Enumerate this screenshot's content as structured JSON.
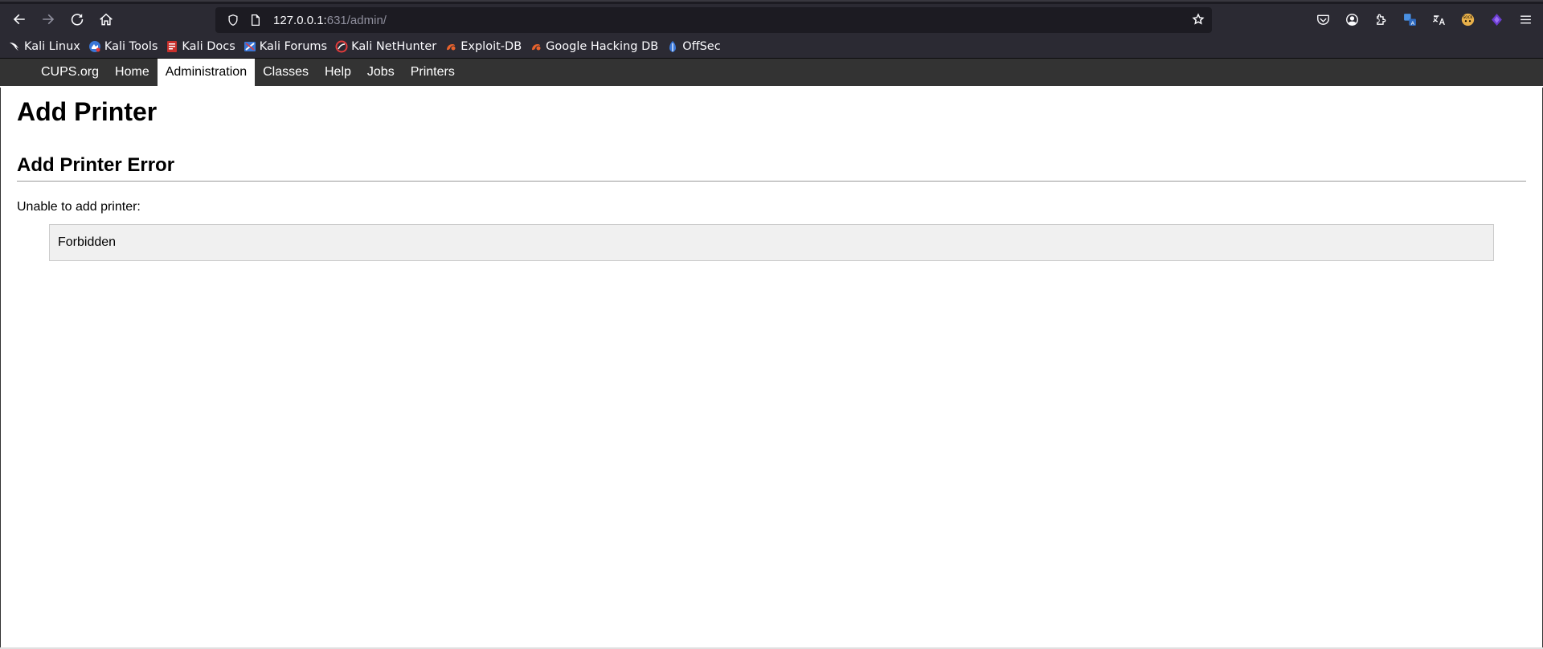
{
  "browser": {
    "url_host": "127.0.0.1:",
    "url_rest": "631/admin/",
    "bookmarks": [
      {
        "label": "Kali Linux",
        "icon": "kali-dragon-icon"
      },
      {
        "label": "Kali Tools",
        "icon": "kali-tools-icon"
      },
      {
        "label": "Kali Docs",
        "icon": "kali-docs-icon"
      },
      {
        "label": "Kali Forums",
        "icon": "kali-forums-icon"
      },
      {
        "label": "Kali NetHunter",
        "icon": "nethunter-icon"
      },
      {
        "label": "Exploit-DB",
        "icon": "exploit-db-icon"
      },
      {
        "label": "Google Hacking DB",
        "icon": "ghdb-icon"
      },
      {
        "label": "OffSec",
        "icon": "offsec-icon"
      }
    ]
  },
  "cups_nav": {
    "items": [
      "CUPS.org",
      "Home",
      "Administration",
      "Classes",
      "Help",
      "Jobs",
      "Printers"
    ],
    "active": "Administration"
  },
  "page": {
    "title": "Add Printer",
    "section_title": "Add Printer Error",
    "message": "Unable to add printer:",
    "error": "Forbidden"
  },
  "colors": {
    "nav_bg": "#333333",
    "chrome_bg": "#2b2a33",
    "urlbar_bg": "#1c1b22",
    "error_box_bg": "#f0f0f0"
  }
}
